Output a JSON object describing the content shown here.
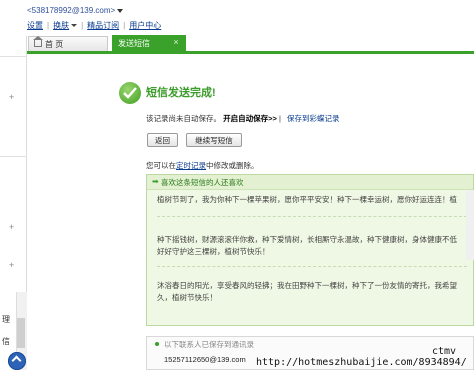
{
  "header": {
    "account": "<538178992@139.com>",
    "links": [
      "设置",
      "换肤",
      "精品订阅",
      "用户中心"
    ]
  },
  "tabs": [
    {
      "label": "首 页",
      "active": false
    },
    {
      "label": "发送短信",
      "active": true,
      "close": "×"
    }
  ],
  "sidebar": {
    "plus_1": "+",
    "plus_2": "+",
    "plus_3": "+",
    "text_1": "理",
    "text_2": "信"
  },
  "result": {
    "title": "短信发送完成!",
    "notice": "该记录尚未自动保存。",
    "auto_save": "开启自动保存>>",
    "save_link": "保存到彩蝶记录"
  },
  "buttons": {
    "back": "返回",
    "continue": "继续写短信"
  },
  "hint": {
    "prefix": "您可以在",
    "link": "定时记录",
    "suffix": "中修改或删除。"
  },
  "recommend": {
    "header": "喜欢这条短信的人还喜欢",
    "items": [
      "植树节到了，我为你种下一棵苹果树，愿你平平安安！种下一棵幸运树，愿你好运连连！植",
      "种下摇钱树，财源滚滚伴你救，种下爱情树，长相厮守永温故，种下健康树，身体健康不低",
      "好好守护这三棵树，植树节快乐！",
      "沐浴春日的阳光，享受春风的轻拂；我在田野种下一棵树，种下了一份友情的寄托，我希望",
      "久，植树节快乐！"
    ]
  },
  "contacts": {
    "title": "以下联系人已保存到通讯录",
    "item": "15257112650@139.com"
  },
  "watermark": {
    "line1": "ctmv",
    "line2": "http://hotmeszhubaijie.com/8934894/"
  },
  "colors": {
    "accent": "#3aa12b",
    "link": "#0a3c8f"
  }
}
